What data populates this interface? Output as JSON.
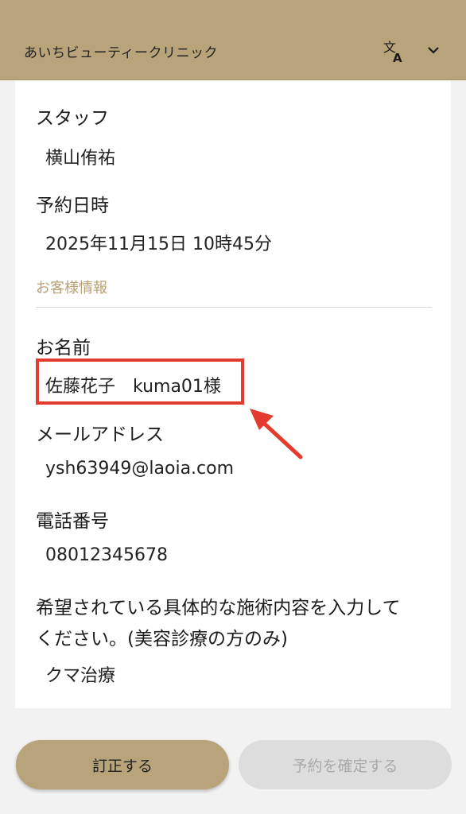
{
  "header": {
    "clinic_name": "あいちビューティークリニック"
  },
  "fields": {
    "staff_label": "スタッフ",
    "staff_value": "横山侑祐",
    "datetime_label": "予約日時",
    "datetime_value": "2025年11月15日 10時45分",
    "customer_section": "お客様情報",
    "name_label": "お名前",
    "name_value": "佐藤花子　kuma01様",
    "email_label": "メールアドレス",
    "email_value": "ysh63949@laoia.com",
    "phone_label": "電話番号",
    "phone_value": "08012345678",
    "treatment_label_line1": "希望されている具体的な施術内容を入力して",
    "treatment_label_line2": "ください。(美容診療の方のみ)",
    "treatment_value": "クマ治療"
  },
  "footer": {
    "correct_label": "訂正する",
    "confirm_label": "予約を確定する"
  },
  "colors": {
    "header_bg": "#b9a37a",
    "accent_text": "#b89f74",
    "highlight": "#e33b2d",
    "disabled_bg": "#dddddd"
  },
  "icons": {
    "translate": "translate-icon",
    "dropdown": "chevron-down-icon",
    "annotation": "annotation-arrow"
  }
}
